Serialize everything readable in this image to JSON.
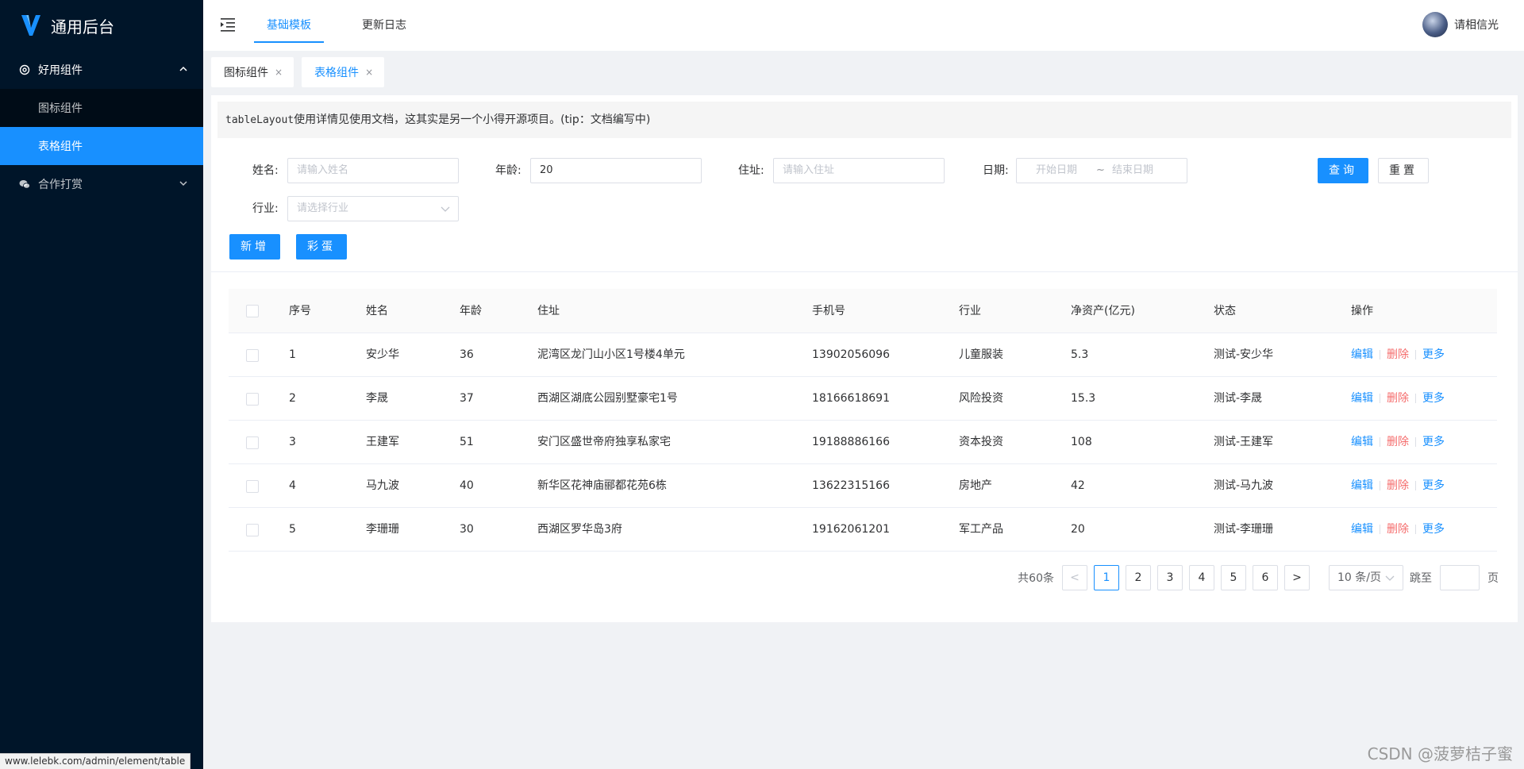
{
  "app": {
    "title": "通用后台"
  },
  "sidebar": {
    "groups": [
      {
        "label": "好用组件",
        "items": [
          {
            "label": "图标组件"
          },
          {
            "label": "表格组件"
          }
        ]
      },
      {
        "label": "合作打赏"
      }
    ]
  },
  "header": {
    "tabs": [
      {
        "label": "基础模板"
      },
      {
        "label": "更新日志"
      }
    ],
    "user": "请相信光"
  },
  "page_tabs": [
    {
      "label": "图标组件",
      "close": "×"
    },
    {
      "label": "表格组件",
      "close": "×"
    }
  ],
  "tip": {
    "code": "tableLayout",
    "text": "使用详情见使用文档，这其实是另一个小得开源项目。(tip：文档编写中)"
  },
  "form": {
    "name": {
      "label": "姓名:",
      "placeholder": "请输入姓名"
    },
    "age": {
      "label": "年龄:",
      "value": "20"
    },
    "address": {
      "label": "住址:",
      "placeholder": "请输入住址"
    },
    "date": {
      "label": "日期:",
      "start_placeholder": "开始日期",
      "separator": "~",
      "end_placeholder": "结束日期"
    },
    "industry": {
      "label": "行业:",
      "placeholder": "请选择行业"
    },
    "query_btn": "查询",
    "reset_btn": "重置",
    "add_btn": "新增",
    "egg_btn": "彩蛋"
  },
  "table": {
    "columns": [
      "序号",
      "姓名",
      "年龄",
      "住址",
      "手机号",
      "行业",
      "净资产(亿元)",
      "状态",
      "操作"
    ],
    "rows": [
      [
        "1",
        "安少华",
        "36",
        "泥湾区龙门山小区1号楼4单元",
        "13902056096",
        "儿童服装",
        "5.3",
        "测试-安少华"
      ],
      [
        "2",
        "李晟",
        "37",
        "西湖区湖底公园别墅豪宅1号",
        "18166618691",
        "风险投资",
        "15.3",
        "测试-李晟"
      ],
      [
        "3",
        "王建军",
        "51",
        "安门区盛世帝府独享私家宅",
        "19188886166",
        "资本投资",
        "108",
        "测试-王建军"
      ],
      [
        "4",
        "马九波",
        "40",
        "新华区花神庙郦都花苑6栋",
        "13622315166",
        "房地产",
        "42",
        "测试-马九波"
      ],
      [
        "5",
        "李珊珊",
        "30",
        "西湖区罗华岛3府",
        "19162061201",
        "军工产品",
        "20",
        "测试-李珊珊"
      ]
    ],
    "ops": {
      "edit": "编辑",
      "delete": "删除",
      "more": "更多"
    }
  },
  "pagination": {
    "total": "共60条",
    "prev": "<",
    "next": ">",
    "pages": [
      "1",
      "2",
      "3",
      "4",
      "5",
      "6"
    ],
    "current": "1",
    "page_size": "10 条/页",
    "jump_label": "跳至",
    "page_unit": "页"
  },
  "statusbar": {
    "url": "www.lelebk.com/admin/element/table"
  },
  "watermark": "CSDN @菠萝桔子蜜",
  "colors": {
    "sidebar": "#001529",
    "submenu": "#000c17",
    "primary": "#1890ff",
    "danger": "#f56c6c"
  }
}
